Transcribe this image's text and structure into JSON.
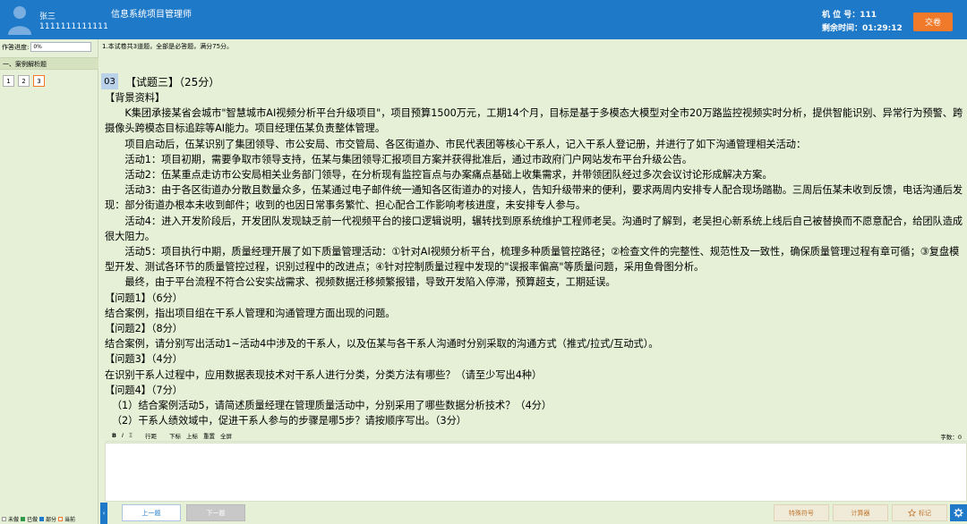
{
  "header": {
    "user_name": "张三",
    "user_id": "1111111111111",
    "title": "信息系统项目管理师",
    "seat_label": "机 位 号：",
    "seat_value": "111",
    "remain_label": "剩余时间：",
    "remain_value": "01:29:12",
    "submit_label": "交卷"
  },
  "sidebar": {
    "progress_label": "作答进度:",
    "progress_value": "0%",
    "section_label": "一、案例解析题",
    "question_numbers": [
      "1",
      "2",
      "3"
    ],
    "legend": [
      "未做",
      "已做",
      "部分",
      "当前"
    ]
  },
  "instructions": "1.本试卷共3道题，全部是必答题，满分75分。",
  "question": {
    "number": "03",
    "title": "【试题三】（25分）",
    "background_heading": "【背景资料】",
    "paragraphs": [
      "K集团承接某省会城市\"智慧城市AI视频分析平台升级项目\"，项目预算1500万元，工期14个月，目标是基于多模态大模型对全市20万路监控视频实时分析，提供智能识别、异常行为预警、跨摄像头跨模态目标追踪等AI能力。项目经理伍某负责整体管理。",
      "项目启动后，伍某识别了集团领导、市公安局、市交管局、各区街道办、市民代表团等核心干系人，记入干系人登记册，并进行了如下沟通管理相关活动：",
      "活动1：项目初期，需要争取市领导支持，伍某与集团领导汇报项目方案并获得批准后，通过市政府门户网站发布平台升级公告。",
      "活动2：伍某重点走访市公安局相关业务部门领导，在分析现有监控盲点与办案痛点基础上收集需求，并带领团队经过多次会议讨论形成解决方案。",
      "活动3：由于各区街道办分散且数量众多，伍某通过电子邮件统一通知各区街道办的对接人，告知升级带来的便利，要求两周内安排专人配合现场踏勘。三周后伍某未收到反馈，电话沟通后发现：部分街道办根本未收到邮件；收到的也因日常事务繁忙、担心配合工作影响考核进度，未安排专人参与。",
      "活动4：进入开发阶段后，开发团队发现缺乏前一代视频平台的接口逻辑说明，辗转找到原系统维护工程师老吴。沟通时了解到，老吴担心新系统上线后自己被替换而不愿意配合，给团队造成很大阻力。",
      "活动5：项目执行中期，质量经理开展了如下质量管理活动：①针对AI视频分析平台，梳理多种质量管控路径；②检查文件的完整性、规范性及一致性，确保质量管理过程有章可循；③复盘模型开发、测试各环节的质量管控过程，识别过程中的改进点；④针对控制质量过程中发现的\"误报率偏高\"等质量问题，采用鱼骨图分析。",
      "最终，由于平台流程不符合公安实战需求、视频数据迁移频繁报错，导致开发陷入停滞，预算超支，工期延误。"
    ],
    "q1_heading": "【问题1】（6分）",
    "q1_text": "结合案例，指出项目组在干系人管理和沟通管理方面出现的问题。",
    "q2_heading": "【问题2】（8分）",
    "q2_text": "结合案例，请分别写出活动1~活动4中涉及的干系人，以及伍某与各干系人沟通时分别采取的沟通方式（推式/拉式/互动式）。",
    "q3_heading": "【问题3】（4分）",
    "q3_text": "在识别干系人过程中，应用数据表现技术对干系人进行分类，分类方法有哪些？（请至少写出4种）",
    "q4_heading": "【问题4】（7分）",
    "q4_sub1": "（1）结合案例活动5，请简述质量经理在管理质量活动中，分别采用了哪些数据分析技术？（4分）",
    "q4_sub2": "（2）干系人绩效域中，促进干系人参与的步骤是哪5步？请按顺序写出。（3分）"
  },
  "editor": {
    "toolbar": [
      "B",
      "I",
      "Ξ",
      "行距",
      "下标",
      "上标",
      "重置",
      "全屏"
    ],
    "word_count_label": "字数：0"
  },
  "footer": {
    "prev_label": "上一题",
    "next_label": "下一题",
    "special_label": "特殊符号",
    "calc_label": "计算器",
    "mark_label": "标记"
  },
  "colors": {
    "header_bg": "#1e79c8",
    "page_bg": "#e6f0d6",
    "accent_orange": "#f07a2a"
  }
}
